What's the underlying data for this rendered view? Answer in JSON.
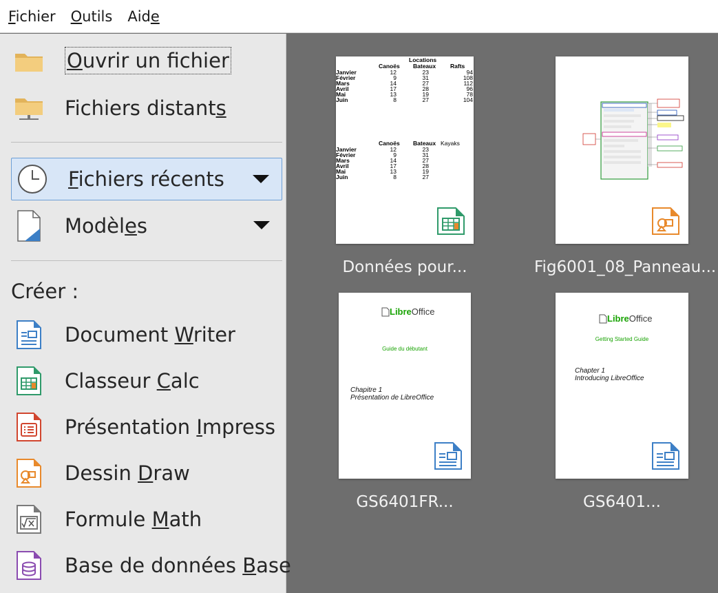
{
  "menubar": {
    "items": [
      {
        "pre": "",
        "key": "F",
        "post": "ichier"
      },
      {
        "pre": "",
        "key": "O",
        "post": "utils"
      },
      {
        "pre": "Aid",
        "key": "e",
        "post": ""
      }
    ]
  },
  "sidebar": {
    "open_file": {
      "pre": "",
      "key": "O",
      "post": "uvrir un fichier",
      "icon": "folder-icon"
    },
    "remote_files": {
      "pre": "Fichiers distant",
      "key": "s",
      "post": "",
      "icon": "remote-folder-icon"
    },
    "recent_files": {
      "pre": "",
      "key": "F",
      "post": "ichiers récents",
      "icon": "clock-icon"
    },
    "templates": {
      "pre": "Modèl",
      "key": "e",
      "post": "s",
      "icon": "template-icon"
    },
    "create_title": "Créer :",
    "create_items": [
      {
        "pre": "Document ",
        "key": "W",
        "post": "riter",
        "icon": "writer-icon",
        "color": "#3c7fc6"
      },
      {
        "pre": "Classeur ",
        "key": "C",
        "post": "alc",
        "icon": "calc-icon",
        "color": "#2f9a6a"
      },
      {
        "pre": "Présentation ",
        "key": "I",
        "post": "mpress",
        "icon": "impress-icon",
        "color": "#d1452e"
      },
      {
        "pre": "Dessin ",
        "key": "D",
        "post": "raw",
        "icon": "draw-icon",
        "color": "#e8892b"
      },
      {
        "pre": "Formule ",
        "key": "M",
        "post": "ath",
        "icon": "math-icon",
        "color": "#7a7a7a"
      },
      {
        "pre": "Base de données ",
        "key": "B",
        "post": "ase",
        "icon": "base-icon",
        "color": "#8a4bb0"
      }
    ]
  },
  "recent": [
    {
      "caption": "Données pour...",
      "kind": "calc"
    },
    {
      "caption": "Fig6001_08_Panneau...",
      "kind": "draw"
    },
    {
      "caption": "GS6401FR...",
      "kind": "writer"
    },
    {
      "caption": "GS6401...",
      "kind": "writer"
    }
  ],
  "thumb_calc": {
    "title": "Locations",
    "headers1": [
      "Canoës",
      "Bateaux",
      "Rafts"
    ],
    "headers2": [
      "Canoës",
      "Bateaux",
      "Kayaks"
    ],
    "months": [
      "Janvier",
      "Février",
      "Mars",
      "Avril",
      "Mai",
      "Juin"
    ],
    "table1": [
      [
        12,
        23,
        94
      ],
      [
        9,
        31,
        108
      ],
      [
        14,
        27,
        112
      ],
      [
        17,
        28,
        96
      ],
      [
        13,
        19,
        78
      ],
      [
        8,
        27,
        104
      ]
    ],
    "table2": [
      [
        12,
        23
      ],
      [
        9,
        31
      ],
      [
        14,
        27
      ],
      [
        17,
        28
      ],
      [
        13,
        19
      ],
      [
        8,
        27
      ]
    ]
  },
  "thumb_doc_fr": {
    "logo_libre": "Libre",
    "logo_office": "Office",
    "subtitle": "Guide du débutant",
    "chapter_line1": "Chapitre 1",
    "chapter_line2": "Présentation de LibreOffice"
  },
  "thumb_doc_en": {
    "logo_libre": "Libre",
    "logo_office": "Office",
    "subtitle": "Getting Started Guide",
    "chapter_line1": "Chapter 1",
    "chapter_line2": "Introducing LibreOffice"
  },
  "colors": {
    "sidebar_bg": "#e8e8e8",
    "start_center_bg": "#6e6e6e",
    "active_item_bg": "#d8e6f7",
    "libreoffice_green": "#18a303"
  }
}
